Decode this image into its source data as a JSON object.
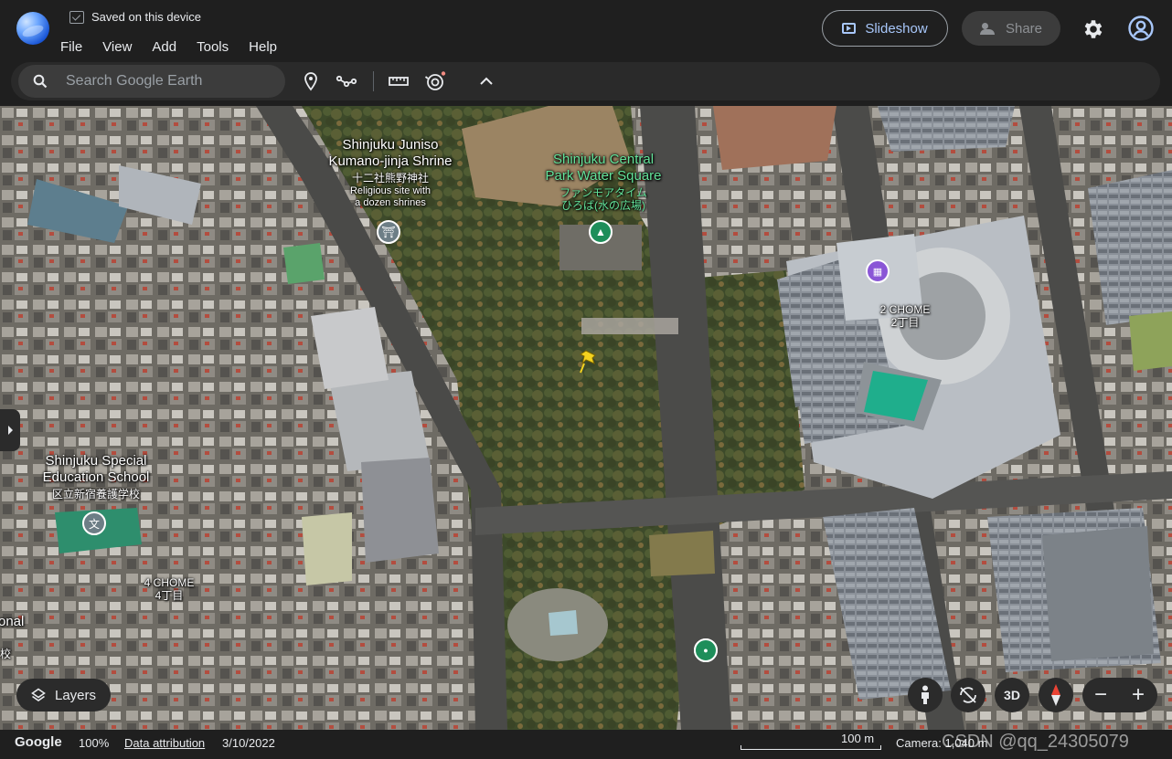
{
  "app": {
    "saved_status": "Saved on this device",
    "menu": [
      "File",
      "View",
      "Add",
      "Tools",
      "Help"
    ],
    "slideshow_label": "Slideshow",
    "share_label": "Share",
    "accent_color": "#a8c7fa"
  },
  "toolbar": {
    "search_placeholder": "Search Google Earth",
    "icons": [
      "placemark-icon",
      "path-icon",
      "measure-icon",
      "voyager-icon",
      "collapse-icon"
    ]
  },
  "map": {
    "labels": {
      "juniso": "Shinjuku Juniso\nKumano-jinja Shrine",
      "juniso_jp": "十二社熊野神社",
      "juniso_desc": "Religious site with\na dozen shrines",
      "water_square": "Shinjuku Central\nPark Water Square",
      "water_square_jp": "ファンモアタイム\nひろば(水の広場)",
      "chome2": "2 CHOME\n2丁目",
      "chome4": "4 CHOME\n4丁目",
      "school": "Shinjuku Special\nEducation School",
      "school_jp": "区立新宿養護学校",
      "school_cut": "onal",
      "school_cut_jp": "校"
    }
  },
  "controls": {
    "layers_label": "Layers",
    "mode_3d_label": "3D",
    "zoom_out": "−",
    "zoom_in": "+"
  },
  "status": {
    "brand": "Google",
    "zoom": "100%",
    "attribution": "Data attribution",
    "date": "3/10/2022",
    "scale": "100 m",
    "camera": "Camera: 1,040 m"
  },
  "watermark": "CSDN @qq_24305079"
}
